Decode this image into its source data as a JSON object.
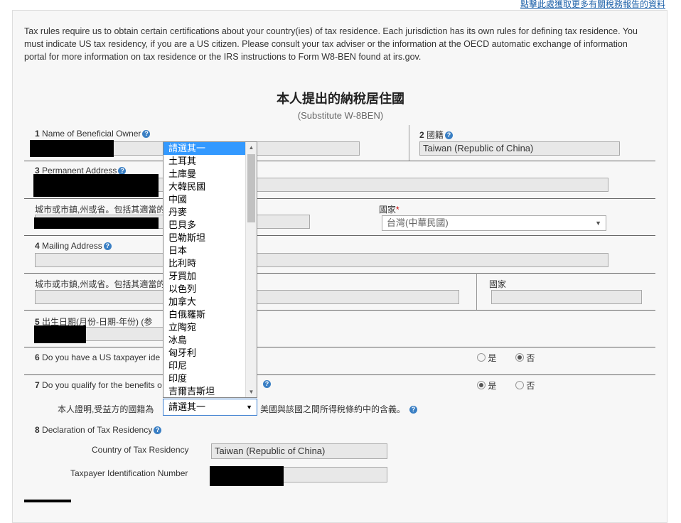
{
  "top_link": "點擊此處獲取更多有關稅務報告的資料",
  "intro": "Tax rules require us to obtain certain certifications about your country(ies) of tax residence. Each jurisdiction has its own rules for defining tax residence. You must indicate US tax residency, if you are a US citizen. Please consult your tax adviser or the information at the OECD automatic exchange of information portal for more information on tax residence or the IRS instructions to Form W8-BEN found at irs.gov.",
  "form_title": "本人提出的納稅居住國",
  "form_subtitle": "(Substitute W-8BEN)",
  "f1": {
    "num": "1",
    "label": "Name of Beneficial Owner"
  },
  "f2": {
    "num": "2",
    "label": "國籍",
    "value": "Taiwan (Republic of China)"
  },
  "f3": {
    "num": "3",
    "label": "Permanent Address",
    "city_label": "城市或市鎮,州或省。包括其適當的",
    "country_label": "國家",
    "required_mark": "*",
    "country_value": "台灣(中華民國)"
  },
  "f4": {
    "num": "4",
    "label": "Mailing Address",
    "city_label": "城市或市鎮,州或省。包括其適當的",
    "country_label": "國家"
  },
  "f5": {
    "num": "5",
    "label": "出生日期(月份-日期-年份) (参"
  },
  "f6": {
    "num": "6",
    "label": "Do you have a US taxpayer ide",
    "yes": "是",
    "no": "否"
  },
  "f7": {
    "num": "7",
    "label": "Do you qualify for the benefits o",
    "yes": "是",
    "no": "否",
    "certify_prefix": "本人證明,受益方的國籍為",
    "certify_suffix": "美國與該國之間所得稅條約中的含義。",
    "combo_value": "請選其一"
  },
  "f8": {
    "num": "8",
    "label": "Declaration of Tax Residency",
    "country_label": "Country of Tax Residency",
    "country_value": "Taiwan (Republic of China)",
    "tin_label": "Taxpayer Identification Number"
  },
  "dropdown_items": [
    "請選其一",
    "土耳其",
    "土庫曼",
    "大韓民國",
    "中國",
    "丹麥",
    "巴貝多",
    "巴勒斯坦",
    "日本",
    "比利時",
    "牙買加",
    "以色列",
    "加拿大",
    "白俄羅斯",
    "立陶宛",
    "冰島",
    "匈牙利",
    "印尼",
    "印度",
    "吉爾吉斯坦"
  ],
  "help_glyph": "?"
}
